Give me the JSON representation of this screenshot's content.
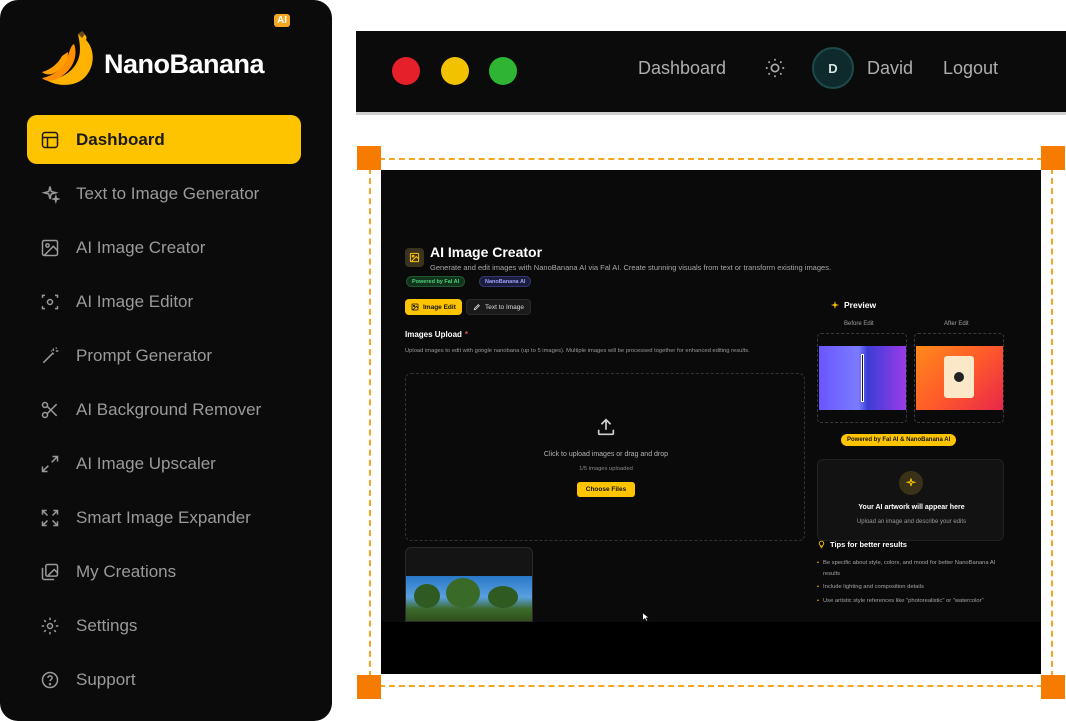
{
  "brand": {
    "name": "NanoBanana",
    "ai_badge": "AI"
  },
  "sidebar": {
    "items": [
      {
        "label": "Dashboard",
        "icon": "layout-icon",
        "active": true
      },
      {
        "label": "Text to Image Generator",
        "icon": "sparkles-icon"
      },
      {
        "label": "AI Image Creator",
        "icon": "image-icon"
      },
      {
        "label": "AI Image Editor",
        "icon": "scan-edit-icon"
      },
      {
        "label": "Prompt Generator",
        "icon": "magic-wand-icon"
      },
      {
        "label": "AI Background Remover",
        "icon": "scissors-icon"
      },
      {
        "label": "AI Image Upscaler",
        "icon": "arrows-expand-icon"
      },
      {
        "label": "Smart Image Expander",
        "icon": "maximize-icon"
      },
      {
        "label": "My Creations",
        "icon": "gallery-icon"
      },
      {
        "label": "Settings",
        "icon": "gear-icon"
      },
      {
        "label": "Support",
        "icon": "help-circle-icon"
      }
    ]
  },
  "topbar": {
    "dashboard_label": "Dashboard",
    "avatar_initial": "D",
    "user_name": "David",
    "logout_label": "Logout",
    "theme_icon": "sun-icon"
  },
  "app": {
    "title": "AI Image Creator",
    "subtitle": "Generate and edit images with NanoBanana AI via Fal AI. Create stunning visuals from text or transform existing images.",
    "badges": {
      "fal": "Powered by Fal AI",
      "nano": "NanoBanana AI"
    },
    "tabs": {
      "image_edit": "Image Edit",
      "text_to_image": "Text to Image"
    },
    "upload": {
      "label": "Images Upload",
      "required_mark": "*",
      "description": "Upload images to edit with google nanobana (up to 5 images). Multiple images will be processed together for enhanced editing results.",
      "dropzone_text": "Click to upload images or drag and drop",
      "count_text": "1/5 images uploaded",
      "choose_button": "Choose Files"
    },
    "preview": {
      "title": "Preview",
      "before_label": "Before Edit",
      "after_label": "After Edit",
      "powered_badge": "Powered by Fal AI & NanoBanana AI",
      "artwork_title": "Your AI artwork will appear here",
      "artwork_sub": "Upload an image and describe your edits"
    },
    "tips": {
      "title": "Tips for better results",
      "items": [
        "Be specific about style, colors, and mood for better NanoBanana AI results",
        "Include lighting and composition details",
        "Use artistic style references like \"photorealistic\" or \"watercolor\""
      ]
    }
  },
  "colors": {
    "accent": "#ffc400",
    "frame": "#f5a623",
    "handle": "#f57c00"
  }
}
